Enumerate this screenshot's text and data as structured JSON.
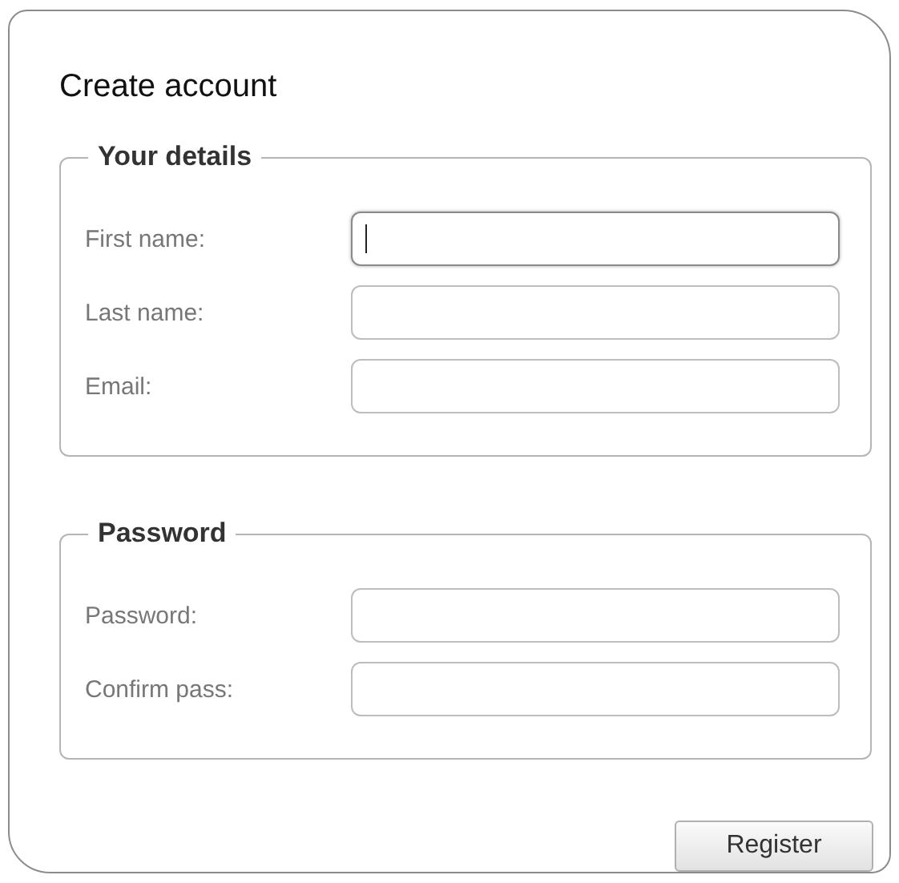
{
  "title": "Create account",
  "sections": [
    {
      "legend": "Your details",
      "fields": [
        {
          "label": "First name:",
          "focused": true
        },
        {
          "label": "Last name:",
          "focused": false
        },
        {
          "label": "Email:",
          "focused": false
        }
      ]
    },
    {
      "legend": "Password",
      "fields": [
        {
          "label": "Password:",
          "focused": false
        },
        {
          "label": "Confirm pass:",
          "focused": false
        }
      ]
    }
  ],
  "button": "Register"
}
